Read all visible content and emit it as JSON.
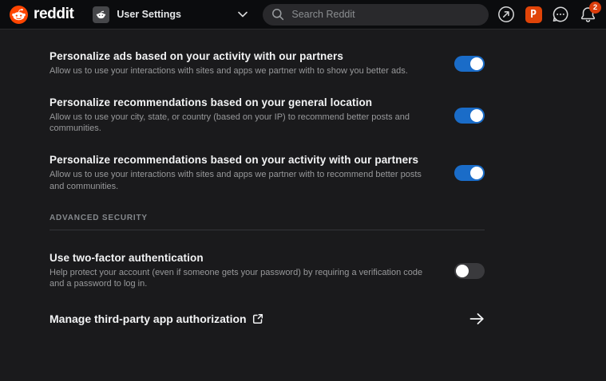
{
  "navbar": {
    "brand": "reddit",
    "context_selector": {
      "label": "User Settings"
    },
    "search": {
      "placeholder": "Search Reddit"
    },
    "actions": {
      "advertise": {
        "icon": "arrow-up-right-circle-icon"
      },
      "p_app": {
        "label": "P"
      },
      "chat": {
        "icon": "chat-bubble-ellipsis-icon"
      },
      "notifications": {
        "icon": "bell-icon",
        "badge": "2"
      }
    }
  },
  "settings": {
    "toggles": [
      {
        "title": "Personalize ads based on your activity with our partners",
        "description": "Allow us to use your interactions with sites and apps we partner with to show you better ads.",
        "enabled": true
      },
      {
        "title": "Personalize recommendations based on your general location",
        "description": "Allow us to use your city, state, or country (based on your IP) to recommend better posts and communities.",
        "enabled": true
      },
      {
        "title": "Personalize recommendations based on your activity with our partners",
        "description": "Allow us to use your interactions with sites and apps we partner with to recommend better posts and communities.",
        "enabled": true
      },
      {
        "title": "Use two-factor authentication",
        "description": "Help protect your account (even if someone gets your password) by requiring a verification code and a password to log in.",
        "enabled": false
      }
    ],
    "section_header": "ADVANCED SECURITY",
    "link_row": {
      "label": "Manage third-party app authorization"
    }
  },
  "colors": {
    "brand_orange": "#ff4500",
    "toggle_on_blue": "#1a6cc8",
    "badge_red": "#dc3d0c",
    "navbar_bg": "#0b0c0e",
    "content_bg": "#1a1a1c"
  }
}
